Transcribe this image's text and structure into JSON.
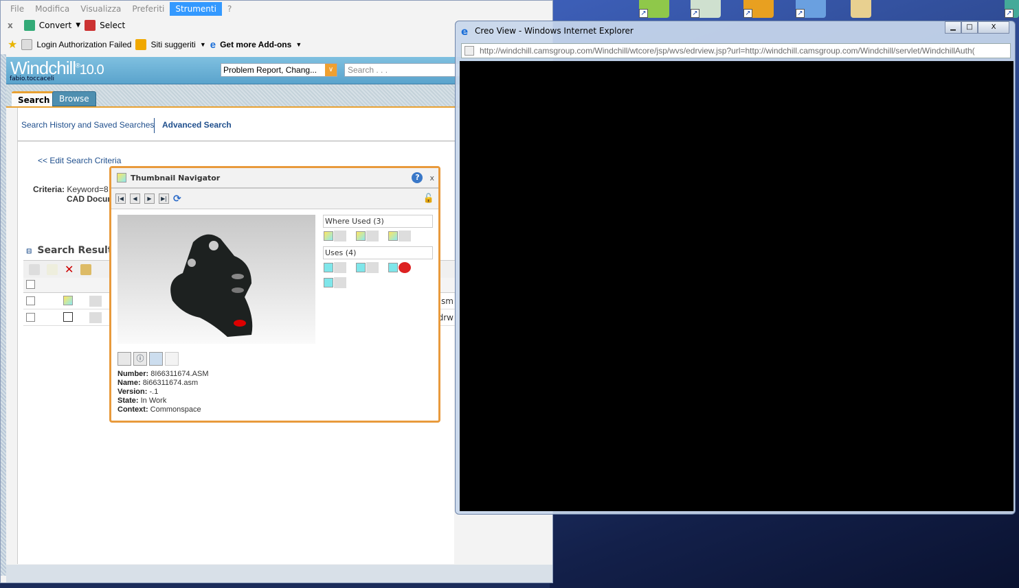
{
  "menu": [
    "File",
    "Modifica",
    "Visualizza",
    "Preferiti",
    "Strumenti",
    "?"
  ],
  "menu_active": "Strumenti",
  "toolbar": {
    "close": "x",
    "convert": "Convert",
    "select": "Select"
  },
  "favorites": {
    "login": "Login Authorization Failed",
    "sites": "Siti suggeriti",
    "addons": "Get more Add-ons"
  },
  "windchill": {
    "logo": "Windchill",
    "version": "10.0",
    "user": "fabio.toccaceli",
    "type_select": "Problem Report, Chang...",
    "search_placeholder": "Search . . ."
  },
  "tabs": [
    "Search",
    "Browse"
  ],
  "links": {
    "history": "Search History and Saved Searches",
    "advanced": "Advanced Search",
    "edit": "<< Edit Search Criteria"
  },
  "criteria": {
    "label": "Criteria:",
    "line1": "Keyword=8",
    "line2": "CAD Docun"
  },
  "results": {
    "title": "Search Results",
    "rows": [
      {
        "suffix": "sm"
      },
      {
        "suffix": "drw"
      }
    ]
  },
  "popup": {
    "title": "Thumbnail Navigator",
    "close": "x",
    "where_used": "Where Used (3)",
    "uses": "Uses (4)",
    "fields": [
      {
        "label": "Number:",
        "value": "8I66311674.ASM"
      },
      {
        "label": "Name:",
        "value": "8i66311674.asm"
      },
      {
        "label": "Version:",
        "value": "-.1"
      },
      {
        "label": "State:",
        "value": "In Work"
      },
      {
        "label": "Context:",
        "value": "Commonspace"
      }
    ]
  },
  "creo": {
    "title": "Creo View - Windows Internet Explorer",
    "url_host": "http://windchill.camsgroup.com",
    "url_domain": "windchill.camsgroup.com",
    "url_rest": "/Windchill/wtcore/jsp/wvs/edrview.jsp?url=http://windchill.camsgroup.com/Windchill/servlet/WindchillAuth(",
    "min": "▁",
    "max": "□",
    "close": "X"
  },
  "colors": {
    "accent": "#e89a3c",
    "header": "#5aa3cc",
    "menu_active": "#3399ff"
  }
}
